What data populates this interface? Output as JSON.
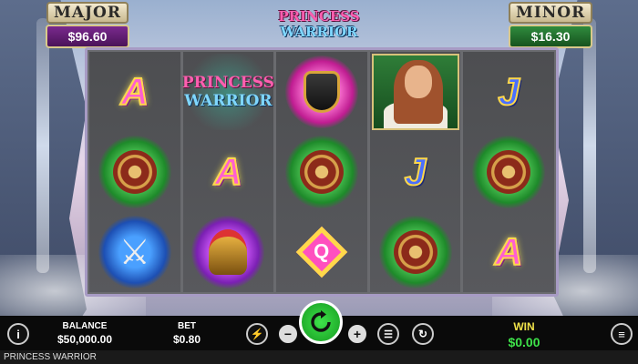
{
  "jackpots": {
    "major": {
      "label": "MAJOR",
      "amount": "$96.60"
    },
    "minor": {
      "label": "MINOR",
      "amount": "$16.30"
    }
  },
  "logo": {
    "line1": "PRINCESS",
    "line2": "WARRIOR"
  },
  "reels": [
    [
      "A",
      "shield",
      "swords"
    ],
    [
      "game-logo",
      "A",
      "helmet"
    ],
    [
      "cup",
      "shield",
      "Q"
    ],
    [
      "princess",
      "J",
      "shield"
    ],
    [
      "J",
      "shield",
      "A"
    ]
  ],
  "symbol_logo": {
    "line1": "PRINCESS",
    "line2": "WARRIOR"
  },
  "bar": {
    "balance_label": "BALANCE",
    "balance_value": "$50,000.00",
    "bet_label": "BET",
    "bet_value": "$0.80",
    "win_label": "WIN",
    "win_value": "$0.00",
    "info_icon": "i",
    "minus": "−",
    "plus": "+",
    "menu_icon": "≡"
  },
  "footer": {
    "title": "PRINCESS WARRIOR"
  },
  "colors": {
    "spin": "#1fbf2a",
    "win_value": "#3ee24a",
    "win_label": "#f0e24a"
  }
}
